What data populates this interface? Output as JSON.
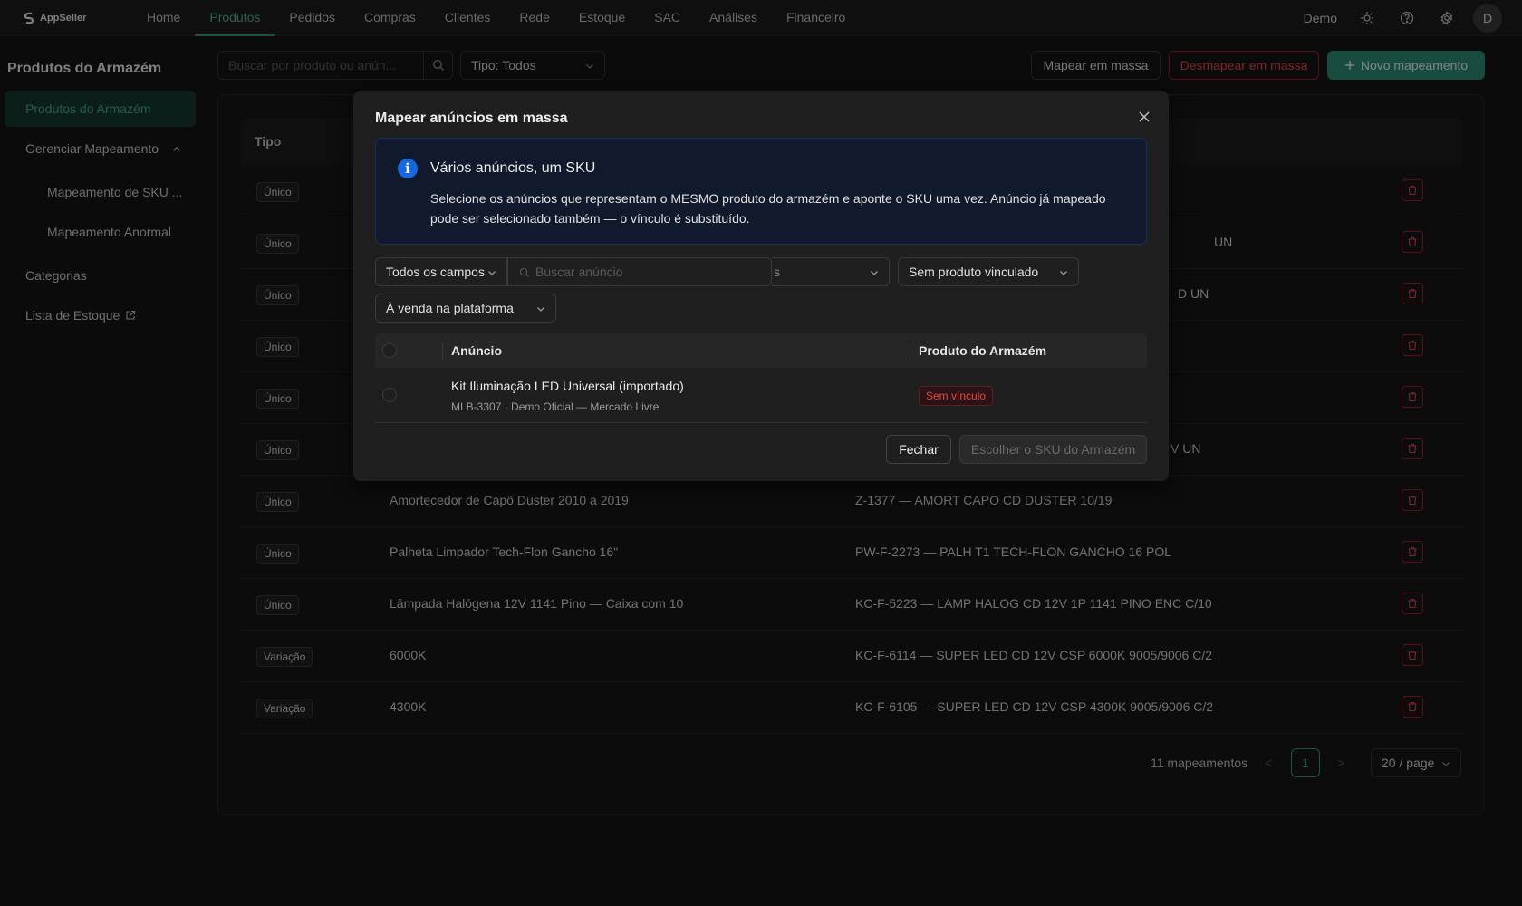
{
  "app": {
    "logo_text": "AppSeller"
  },
  "nav": {
    "items": [
      "Home",
      "Produtos",
      "Pedidos",
      "Compras",
      "Clientes",
      "Rede",
      "Estoque",
      "SAC",
      "Análises",
      "Financeiro"
    ],
    "active_index": 1
  },
  "user": {
    "name": "Demo",
    "avatar_initial": "D"
  },
  "icons": {
    "theme": "sun-icon",
    "help": "question-circle-icon",
    "settings": "gear-icon"
  },
  "sidebar": {
    "title": "Produtos do Armazém",
    "items": [
      {
        "label": "Produtos do Armazém",
        "active": true
      },
      {
        "label": "Gerenciar Mapeamento",
        "expanded": true
      },
      {
        "label": "Mapeamento de SKU ..."
      },
      {
        "label": "Mapeamento Anormal"
      },
      {
        "label": "Categorias"
      },
      {
        "label": "Lista de Estoque",
        "icon": "external-link-icon"
      }
    ]
  },
  "toolbar": {
    "search_placeholder": "Buscar por produto ou anún...",
    "type_filter": "Tipo: Todos",
    "map_bulk": "Mapear em massa",
    "unmap_bulk": "Desmapear em massa",
    "new_mapping": "Novo mapeamento"
  },
  "table": {
    "header_tipo": "Tipo",
    "rows": [
      {
        "tipo": "Único",
        "name": "",
        "sku": ""
      },
      {
        "tipo": "Único",
        "name": "",
        "sku": "UN"
      },
      {
        "tipo": "Único",
        "name": "",
        "sku": "D UN"
      },
      {
        "tipo": "Único",
        "name": "",
        "sku": ""
      },
      {
        "tipo": "Único",
        "name": "",
        "sku": ""
      },
      {
        "tipo": "Único",
        "name": "",
        "sku": "V UN"
      },
      {
        "tipo": "Único",
        "name": "Amortecedor de Capô Duster 2010 a 2019",
        "sku": "Z-1377 — AMORT CAPO CD DUSTER 10/19"
      },
      {
        "tipo": "Único",
        "name": "Palheta Limpador Tech-Flon Gancho 16\"",
        "sku": "PW-F-2273 — PALH T1 TECH-FLON GANCHO 16 POL"
      },
      {
        "tipo": "Único",
        "name": "Lâmpada Halógena 12V 1141 Pino — Caixa com 10",
        "sku": "KC-F-5223 — LAMP HALOG CD 12V 1P 1141 PINO ENC C/10"
      },
      {
        "tipo": "Variação",
        "name": "6000K",
        "sku": "KC-F-6114 — SUPER LED CD 12V CSP 6000K 9005/9006 C/2"
      },
      {
        "tipo": "Variação",
        "name": "4300K",
        "sku": "KC-F-6105 — SUPER LED CD 12V CSP 4300K 9005/9006 C/2"
      }
    ]
  },
  "pagination": {
    "total": "11 mapeamentos",
    "prev": "<",
    "current": "1",
    "next": ">",
    "page_size": "20 / page"
  },
  "modal": {
    "title": "Mapear anúncios em massa",
    "alert": {
      "title": "Vários anúncios, um SKU",
      "description": "Selecione os anúncios que representam o MESMO produto do armazém e aponte o SKU uma vez. Anúncio já mapeado pode ser selecionado também — o vínculo é substituído."
    },
    "filters": {
      "field": "Todos os campos",
      "search_placeholder": "Buscar anúncio",
      "hidden_select_tail": "s",
      "link_status": "Sem produto vinculado",
      "platform_status": "À venda na plataforma"
    },
    "table": {
      "col_listing": "Anúncio",
      "col_product": "Produto do Armazém",
      "rows": [
        {
          "title": "Kit Iluminação LED Universal (importado)",
          "subtitle": "MLB-3307 · Demo Oficial — Mercado Livre",
          "status": "Sem vínculo"
        }
      ]
    },
    "buttons": {
      "close": "Fechar",
      "choose_sku": "Escolher o SKU do Armazém"
    }
  }
}
